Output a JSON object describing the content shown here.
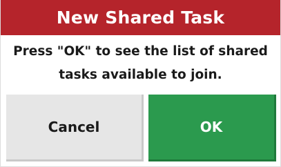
{
  "dialog": {
    "title": "New Shared Task",
    "message_line1": "Press \"OK\" to see the list of shared",
    "message_line2": "tasks available to join.",
    "cancel_label": "Cancel",
    "ok_label": "OK"
  },
  "colors": {
    "title_bar": "#b5242b",
    "ok_button": "#2b9a4e",
    "cancel_button": "#e6e6e6"
  }
}
